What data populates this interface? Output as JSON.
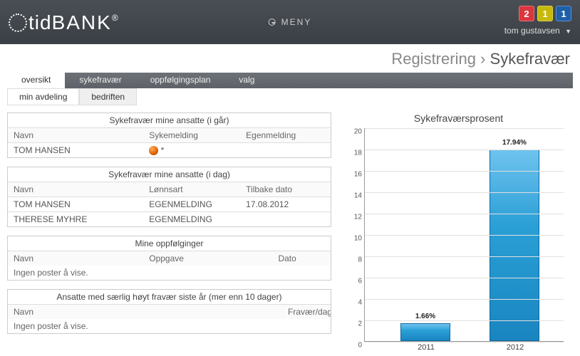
{
  "header": {
    "logo_tid": "tid",
    "logo_bank": "BANK",
    "logo_r": "®",
    "menu": "MENY",
    "badges": [
      "2",
      "1",
      "1"
    ],
    "user": "tom gustavsen"
  },
  "breadcrumb": {
    "parent": "Registrering",
    "current": "Sykefravær"
  },
  "tabs": [
    {
      "id": "oversikt",
      "label": "oversikt",
      "active": true
    },
    {
      "id": "sykefravaer",
      "label": "sykefravær",
      "active": false
    },
    {
      "id": "oppfolgingsplan",
      "label": "oppfølgingsplan",
      "active": false
    },
    {
      "id": "valg",
      "label": "valg",
      "active": false
    }
  ],
  "subtabs": [
    {
      "id": "min-avdeling",
      "label": "min avdeling",
      "active": true
    },
    {
      "id": "bedriften",
      "label": "bedriften",
      "active": false
    }
  ],
  "panels": {
    "yesterday": {
      "title": "Sykefravær mine ansatte (i går)",
      "cols": [
        "Navn",
        "Sykemelding",
        "Egenmelding"
      ],
      "rows": [
        {
          "navn": "TOM HANSEN",
          "sykemelding_icon": "orange-dot",
          "sykemelding_suffix": "*",
          "egenmelding": ""
        }
      ]
    },
    "today": {
      "title": "Sykefravær mine ansatte (i dag)",
      "cols": [
        "Navn",
        "Lønnsart",
        "Tilbake dato"
      ],
      "rows": [
        {
          "navn": "TOM HANSEN",
          "lonnsart": "EGENMELDING",
          "dato": "17.08.2012"
        },
        {
          "navn": "THERESE MYHRE",
          "lonnsart": "EGENMELDING",
          "dato": ""
        }
      ]
    },
    "followups": {
      "title": "Mine oppfølginger",
      "cols": [
        "Navn",
        "Oppgave",
        "Dato"
      ],
      "empty": "Ingen poster å vise."
    },
    "high": {
      "title": "Ansatte med særlig høyt fravær siste år (mer enn 10 dager)",
      "cols": [
        "Navn",
        "Fravær/dager"
      ],
      "empty": "Ingen poster å vise."
    }
  },
  "chart_data": {
    "type": "bar",
    "title": "Sykefraværsprosent",
    "categories": [
      "2011",
      "2012"
    ],
    "values": [
      1.66,
      17.94
    ],
    "value_labels": [
      "1.66%",
      "17.94%"
    ],
    "xlabel": "",
    "ylabel": "",
    "ylim": [
      0,
      20
    ],
    "yticks": [
      0,
      2,
      4,
      6,
      8,
      10,
      12,
      14,
      16,
      18,
      20
    ]
  }
}
